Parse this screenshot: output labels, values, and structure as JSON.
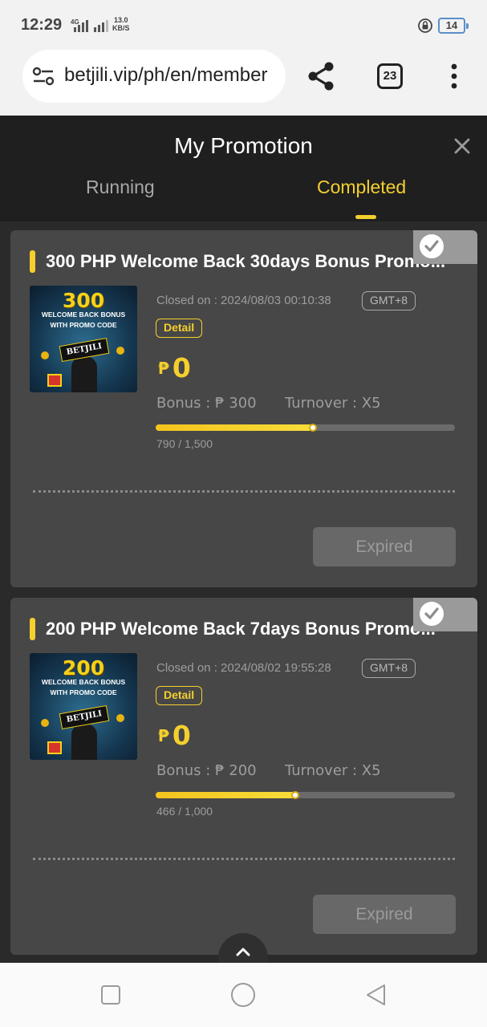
{
  "status_bar": {
    "time": "12:29",
    "network": "4G",
    "speed_value": "13.0",
    "speed_unit": "KB/S",
    "battery": "14"
  },
  "browser": {
    "url": "betjili.vip/ph/en/member",
    "tab_count": "23"
  },
  "header": {
    "title": "My Promotion",
    "tabs": [
      {
        "label": "Running",
        "active": false
      },
      {
        "label": "Completed",
        "active": true
      }
    ]
  },
  "promotions": [
    {
      "title": "300 PHP Welcome Back 30days Bonus Promo...",
      "image": {
        "amount": "300",
        "line1": "WELCOME BACK BONUS",
        "line2": "WITH PROMO CODE",
        "brand": "BETJILI"
      },
      "closed_on": "Closed on : 2024/08/03 00:10:38",
      "timezone": "GMT+8",
      "detail_label": "Detail",
      "currency_symbol": "₱",
      "amount": "0",
      "bonus": "Bonus : ₱ 300",
      "turnover": "Turnover : X5",
      "progress_current": 790,
      "progress_target": 1500,
      "progress_text": "790 / 1,500",
      "status_label": "Expired",
      "completed": true
    },
    {
      "title": "200 PHP Welcome Back 7days Bonus Promo...",
      "image": {
        "amount": "200",
        "line1": "WELCOME BACK BONUS",
        "line2": "WITH PROMO CODE",
        "brand": "BETJILI"
      },
      "closed_on": "Closed on : 2024/08/02 19:55:28",
      "timezone": "GMT+8",
      "detail_label": "Detail",
      "currency_symbol": "₱",
      "amount": "0",
      "bonus": "Bonus : ₱ 200",
      "turnover": "Turnover : X5",
      "progress_current": 466,
      "progress_target": 1000,
      "progress_text": "466 / 1,000",
      "status_label": "Expired",
      "completed": true
    }
  ],
  "colors": {
    "accent": "#f5cf2e",
    "header_bg": "#1f1f1f",
    "card_bg": "#474747",
    "page_bg": "#2a2a2a"
  },
  "icons": {
    "close": "close-icon",
    "share": "share-icon",
    "menu": "more-vert-icon",
    "site_settings": "tune-icon",
    "scroll_top": "chevron-up-icon",
    "completed": "check-circle-icon"
  }
}
